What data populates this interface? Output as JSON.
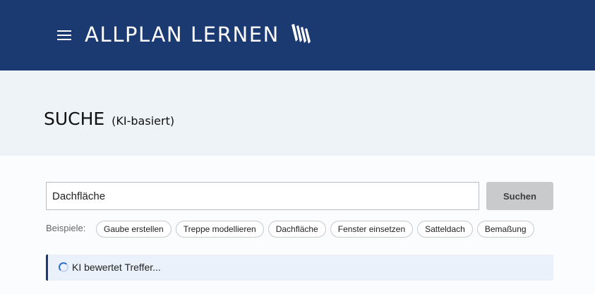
{
  "header": {
    "brand": "ALLPLAN LERNEN",
    "menu_icon": "hamburger-menu-icon",
    "logo_icon": "open-book-icon",
    "background": "#1c3a72"
  },
  "hero": {
    "title": "SUCHE",
    "subtitle": "(KI-basiert)"
  },
  "search": {
    "value": "Dachfläche",
    "button_label": "Suchen"
  },
  "examples": {
    "label": "Beispiele:",
    "items": [
      "Gaube erstellen",
      "Treppe modellieren",
      "Dachfläche",
      "Fenster einsetzen",
      "Satteldach",
      "Bemaßung"
    ]
  },
  "status": {
    "text": "KI bewertet Treffer...",
    "icon": "loading-spinner-icon"
  }
}
